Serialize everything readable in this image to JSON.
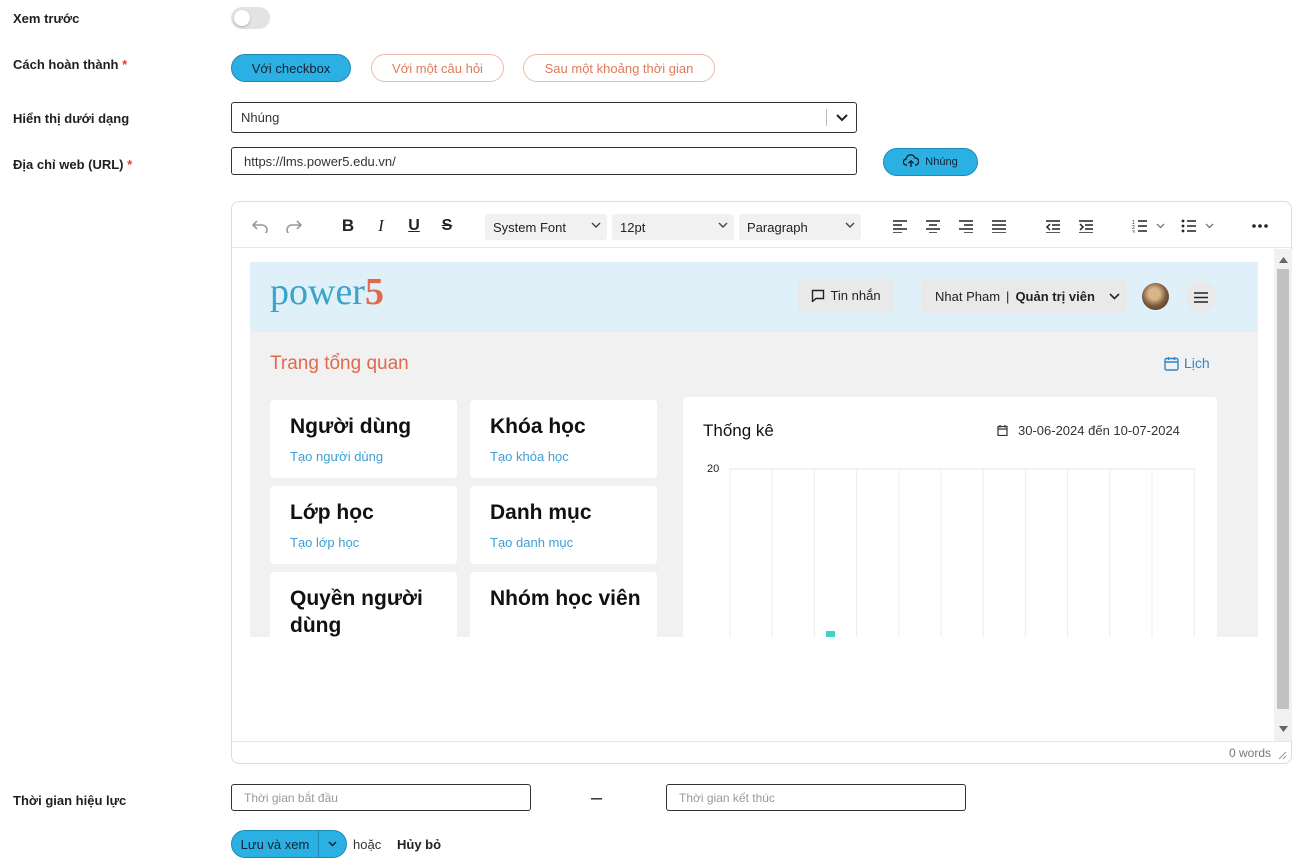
{
  "form": {
    "preview_label": "Xem trước",
    "completion_label": "Cách hoàn thành",
    "required_mark": "*",
    "completion_options": [
      "Với checkbox",
      "Với một câu hỏi",
      "Sau một khoảng thời gian"
    ],
    "completion_selected": "Với checkbox",
    "display_label": "Hiển thị dưới dạng",
    "display_value": "Nhúng",
    "url_label": "Địa chỉ web (URL)",
    "url_value": "https://lms.power5.edu.vn/",
    "embed_button": "Nhúng",
    "validity_label": "Thời gian hiệu lực",
    "start_placeholder": "Thời gian bắt đầu",
    "end_placeholder": "Thời gian kết thúc",
    "range_dash": "–",
    "save_button": "Lưu và xem",
    "or_text": "hoặc",
    "cancel_link": "Hủy bỏ"
  },
  "editor": {
    "font_family": "System Font",
    "font_size": "12pt",
    "block_format": "Paragraph",
    "word_count": "0 words"
  },
  "embedded_page": {
    "logo_text": "power",
    "logo_digit": "5",
    "messages_button": "Tin nhắn",
    "user_name": "Nhat Pham",
    "user_separator": "|",
    "user_role": "Quản trị viên",
    "page_title": "Trang tổng quan",
    "calendar_link": "Lịch",
    "cards": [
      {
        "title": "Người dùng",
        "subtitle": "Tạo người dùng"
      },
      {
        "title": "Khóa học",
        "subtitle": "Tạo khóa học"
      },
      {
        "title": "Lớp học",
        "subtitle": "Tạo lớp học"
      },
      {
        "title": "Danh mục",
        "subtitle": "Tạo danh mục"
      },
      {
        "title": "Quyền người dùng",
        "subtitle": ""
      },
      {
        "title": "Nhóm học viên",
        "subtitle": ""
      }
    ],
    "stats_title": "Thống kê",
    "stats_date_range": "30-06-2024 đến 10-07-2024",
    "y_axis_max": "20"
  },
  "colors": {
    "primary": "#2bb0e3",
    "accent": "#e07a56",
    "required": "#e53935",
    "header_bg": "#dff0f8",
    "bar_color": "#3fd3c9"
  }
}
